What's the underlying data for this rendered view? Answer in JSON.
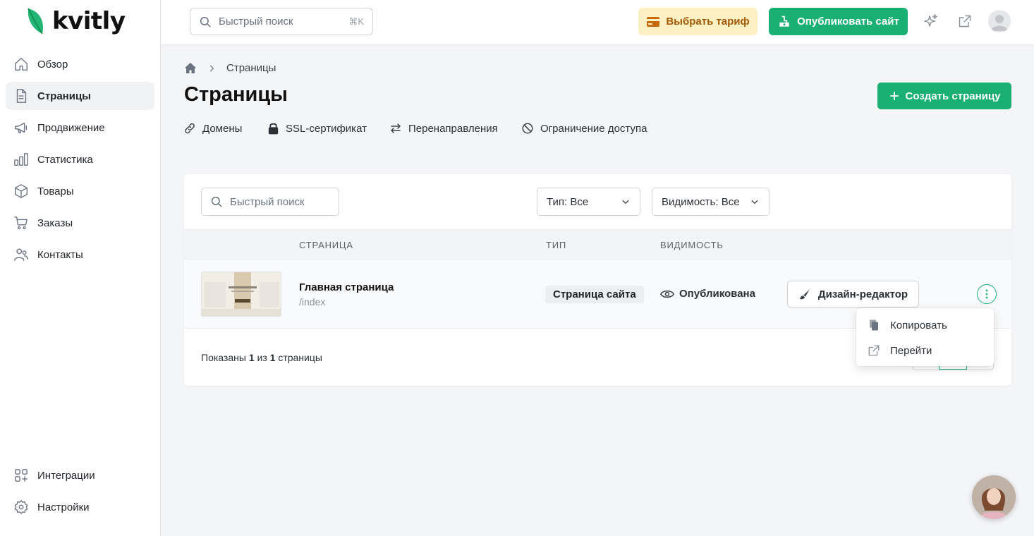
{
  "brand": {
    "name": "kvitly",
    "accent": "#1ab074"
  },
  "sidebar": {
    "items": [
      {
        "label": "Обзор",
        "icon": "home-icon"
      },
      {
        "label": "Страницы",
        "icon": "file-icon",
        "active": true
      },
      {
        "label": "Продвижение",
        "icon": "megaphone-icon"
      },
      {
        "label": "Статистика",
        "icon": "bar-chart-icon"
      },
      {
        "label": "Товары",
        "icon": "box-icon"
      },
      {
        "label": "Заказы",
        "icon": "cart-icon"
      },
      {
        "label": "Контакты",
        "icon": "users-icon"
      }
    ],
    "bottom": [
      {
        "label": "Интеграции",
        "icon": "grid-plus-icon"
      },
      {
        "label": "Настройки",
        "icon": "gear-icon"
      }
    ]
  },
  "header": {
    "search_placeholder": "Быстрый поиск",
    "search_shortcut": "⌘K",
    "tariff_label": "Выбрать тариф",
    "publish_label": "Опубликовать сайт"
  },
  "breadcrumb": {
    "current": "Страницы"
  },
  "page": {
    "title": "Страницы",
    "create_label": "Создать страницу",
    "subnav": [
      "Домены",
      "SSL-сертификат",
      "Перенаправления",
      "Ограничение доступа"
    ]
  },
  "filters": {
    "search_placeholder": "Быстрый поиск",
    "type": "Тип: Все",
    "visibility": "Видимость: Все"
  },
  "table": {
    "columns": [
      "СТРАНИЦА",
      "ТИП",
      "ВИДИМОСТЬ"
    ],
    "rows": [
      {
        "name": "Главная страница",
        "path": "/index",
        "type": "Страница сайта",
        "visibility": "Опубликована",
        "action": "Дизайн-редактор"
      }
    ],
    "footer": {
      "prefix": "Показаны ",
      "shown": "1",
      "middle": " из ",
      "total": "1",
      "suffix": " страницы"
    }
  },
  "row_menu": {
    "items": [
      "Копировать",
      "Перейти"
    ]
  }
}
